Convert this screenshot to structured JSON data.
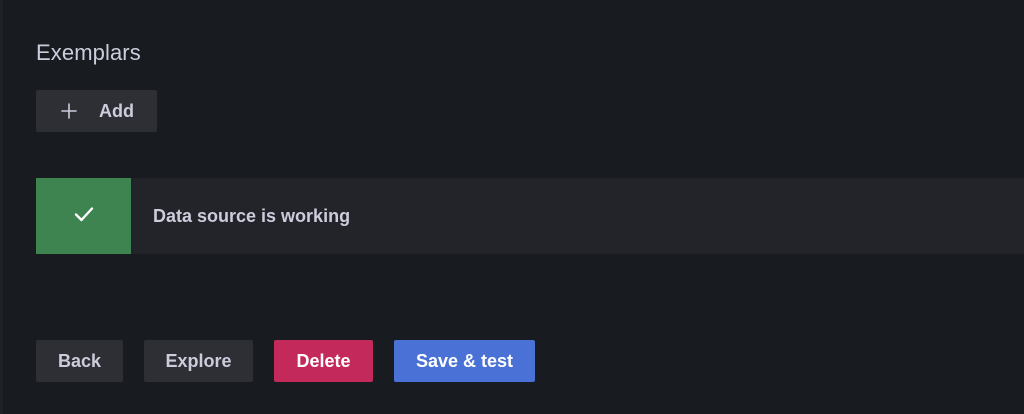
{
  "exemplars": {
    "title": "Exemplars",
    "add_button": {
      "label": "Add",
      "icon": "plus-icon"
    }
  },
  "alert": {
    "status": "success",
    "icon": "check-icon",
    "message": "Data source is working",
    "colors": {
      "icon_background": "#3d8451",
      "background": "#222429"
    }
  },
  "actions": {
    "back_label": "Back",
    "explore_label": "Explore",
    "delete_label": "Delete",
    "save_test_label": "Save & test"
  },
  "colors": {
    "page_background": "#181b1f",
    "secondary_button": "#2d2f35",
    "destructive": "#c4295c",
    "primary": "#4a72d6",
    "text": "#ccccdc"
  }
}
